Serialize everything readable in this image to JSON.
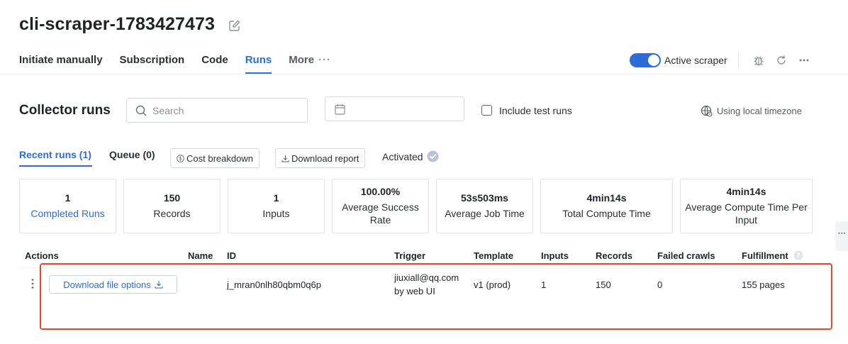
{
  "header": {
    "title": "cli-scraper-1783427473",
    "tabs": [
      {
        "label": "Initiate manually"
      },
      {
        "label": "Subscription"
      },
      {
        "label": "Code"
      },
      {
        "label": "Runs"
      },
      {
        "label": "More"
      }
    ],
    "active_tab": "Runs",
    "active_scraper_label": "Active scraper",
    "active_scraper_on": true
  },
  "filters": {
    "section_title": "Collector runs",
    "search_placeholder": "Search",
    "date_value": "",
    "include_test_runs_label": "Include test runs",
    "include_test_runs_checked": false,
    "timezone_label": "Using local timezone"
  },
  "subtabs": {
    "recent_runs": "Recent runs (1)",
    "queue": "Queue (0)",
    "cost_breakdown": "Cost breakdown",
    "download_report": "Download report",
    "activated": "Activated"
  },
  "stats": [
    {
      "value": "1",
      "label": "Completed Runs"
    },
    {
      "value": "150",
      "label": "Records"
    },
    {
      "value": "1",
      "label": "Inputs"
    },
    {
      "value": "100.00%",
      "label": "Average Success Rate"
    },
    {
      "value": "53s503ms",
      "label": "Average Job Time"
    },
    {
      "value": "4min14s",
      "label": "Total Compute Time"
    },
    {
      "value": "4min14s",
      "label": "Average Compute Time Per Input"
    }
  ],
  "table": {
    "columns": [
      "Actions",
      "Name",
      "ID",
      "Trigger",
      "Template",
      "Inputs",
      "Records",
      "Failed crawls",
      "Fulfillment"
    ],
    "rows": [
      {
        "action_label": "Download file options",
        "name": "",
        "id": "j_mran0nlh80qbm0q6p",
        "trigger_line1": "jiuxiall@qq.com",
        "trigger_line2": "by web UI",
        "template": "v1 (prod)",
        "inputs": "1",
        "records": "150",
        "failed_crawls": "0",
        "fulfillment": "155 pages"
      }
    ]
  },
  "colors": {
    "accent": "#2d6cd8",
    "highlight": "#e8452c",
    "activated_check": "#b8c4d6"
  },
  "icons": {
    "edit": "pencil-square-icon",
    "more": "ellipsis-icon",
    "bug": "bug-icon",
    "refresh": "refresh-icon",
    "menu": "ellipsis-icon",
    "search": "search-icon",
    "calendar": "calendar-icon",
    "globe": "globe-icon",
    "dollar": "dollar-circle-icon",
    "download": "download-icon",
    "check": "check-circle-icon",
    "help": "question-circle-icon",
    "kebab": "kebab-icon"
  }
}
